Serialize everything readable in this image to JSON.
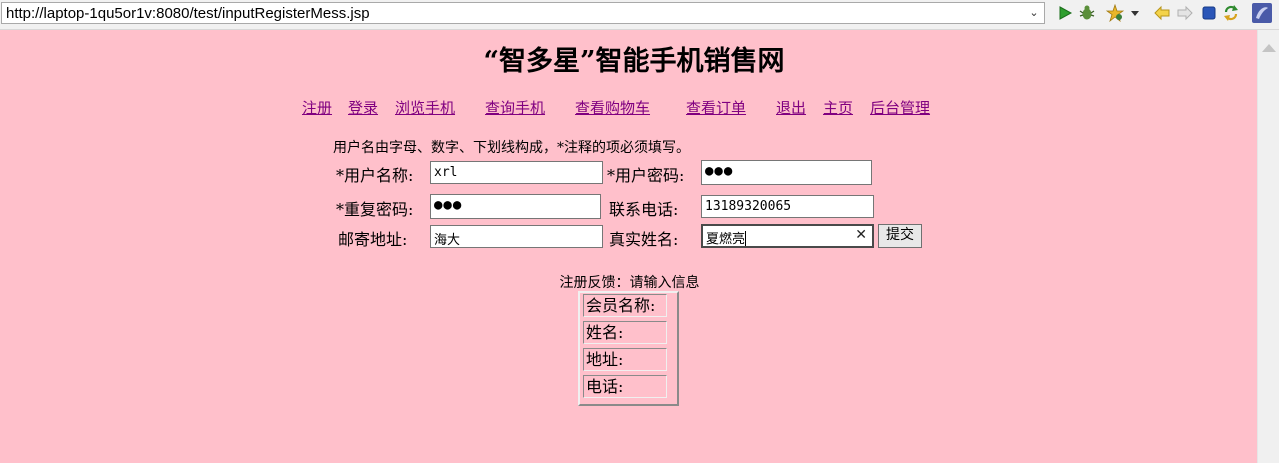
{
  "browser": {
    "url": "http://laptop-1qu5or1v:8080/test/inputRegisterMess.jsp",
    "toolbar_icons": [
      "run-icon",
      "debug-icon",
      "tools-icon",
      "dropdown-icon",
      "back-icon",
      "forward-icon",
      "stop-icon",
      "refresh-icon",
      "browser-app-icon"
    ]
  },
  "page": {
    "title": "“智多星”智能手机销售网",
    "nav": [
      "注册",
      "登录",
      "浏览手机",
      "查询手机",
      "查看购物车",
      "查看订单",
      "退出",
      "主页",
      "后台管理"
    ],
    "hint": "用户名由字母、数字、下划线构成，*注释的项必须填写。",
    "form": {
      "username_label": "*用户名称:",
      "username_value": "xrl",
      "password_label": "*用户密码:",
      "password_value": "●●●",
      "repeat_label": "*重复密码:",
      "repeat_value": "●●●",
      "phone_label": "联系电话:",
      "phone_value": "13189320065",
      "address_label": "邮寄地址:",
      "address_value": "海大",
      "realname_label": "真实姓名:",
      "realname_value": "夏燃亮",
      "submit_label": "提交"
    },
    "feedback": "注册反馈：请输入信息",
    "result_rows": [
      "会员名称:",
      "姓名:",
      "地址:",
      "电话:"
    ]
  },
  "colors": {
    "page_background": "#ffc0cb",
    "link_visited": "#800080"
  }
}
